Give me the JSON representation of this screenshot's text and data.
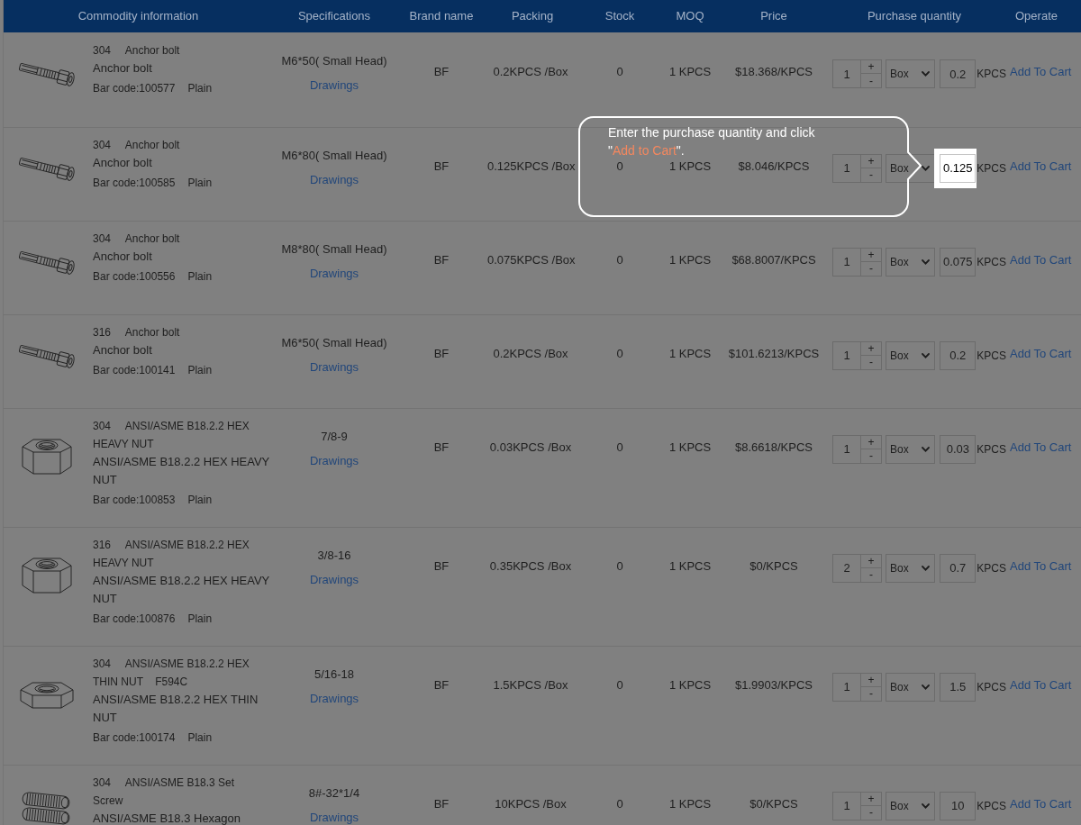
{
  "columns": [
    "Commodity information",
    "Specifications",
    "Brand name",
    "Packing",
    "Stock",
    "MOQ",
    "Price",
    "Purchase quantity",
    "Operate"
  ],
  "rows": [
    {
      "kind": "bolt",
      "grade": "304",
      "title": "Anchor bolt",
      "name": "Anchor bolt",
      "barcode": "Bar code:100577",
      "finish": "Plain",
      "spec": "M6*50( Small Head)",
      "drawings": "Drawings",
      "brand": "BF",
      "packing": "0.2KPCS /Box",
      "stock": "0",
      "moq": "1 KPCS",
      "price": "$18.368/KPCS",
      "quantity": "1",
      "step_up": "+",
      "step_down": "-",
      "unit": "Box",
      "amount": "0.2",
      "amount_unit": "KPCS",
      "highlighted": false,
      "action": "Add To Cart"
    },
    {
      "kind": "bolt",
      "grade": "304",
      "title": "Anchor bolt",
      "name": "Anchor bolt",
      "barcode": "Bar code:100585",
      "finish": "Plain",
      "spec": "M6*80( Small Head)",
      "drawings": "Drawings",
      "brand": "BF",
      "packing": "0.125KPCS /Box",
      "stock": "0",
      "moq": "1 KPCS",
      "price": "$8.046/KPCS",
      "quantity": "1",
      "step_up": "+",
      "step_down": "-",
      "unit": "Box",
      "amount": "0.125",
      "amount_unit": "KPCS",
      "highlighted": true,
      "action": "Add To Cart"
    },
    {
      "kind": "bolt",
      "grade": "304",
      "title": "Anchor bolt",
      "name": "Anchor bolt",
      "barcode": "Bar code:100556",
      "finish": "Plain",
      "spec": "M8*80( Small Head)",
      "drawings": "Drawings",
      "brand": "BF",
      "packing": "0.075KPCS /Box",
      "stock": "0",
      "moq": "1 KPCS",
      "price": "$68.8007/KPCS",
      "quantity": "1",
      "step_up": "+",
      "step_down": "-",
      "unit": "Box",
      "amount": "0.075",
      "amount_unit": "KPCS",
      "highlighted": false,
      "action": "Add To Cart"
    },
    {
      "kind": "bolt",
      "grade": "316",
      "title": "Anchor bolt",
      "name": "Anchor bolt",
      "barcode": "Bar code:100141",
      "finish": "Plain",
      "spec": "M6*50( Small Head)",
      "drawings": "Drawings",
      "brand": "BF",
      "packing": "0.2KPCS /Box",
      "stock": "0",
      "moq": "1 KPCS",
      "price": "$101.6213/KPCS",
      "quantity": "1",
      "step_up": "+",
      "step_down": "-",
      "unit": "Box",
      "amount": "0.2",
      "amount_unit": "KPCS",
      "highlighted": false,
      "action": "Add To Cart"
    },
    {
      "kind": "hex_nut",
      "grade": "304",
      "title": "ANSI/ASME B18.2.2 HEX HEAVY NUT",
      "name": "ANSI/ASME B18.2.2 HEX HEAVY NUT",
      "barcode": "Bar code:100853",
      "finish": "Plain",
      "spec": "7/8-9",
      "drawings": "Drawings",
      "brand": "BF",
      "packing": "0.03KPCS /Box",
      "stock": "0",
      "moq": "1 KPCS",
      "price": "$8.6618/KPCS",
      "quantity": "1",
      "step_up": "+",
      "step_down": "-",
      "unit": "Box",
      "amount": "0.03",
      "amount_unit": "KPCS",
      "highlighted": false,
      "action": "Add To Cart"
    },
    {
      "kind": "hex_nut",
      "grade": "316",
      "title": "ANSI/ASME B18.2.2 HEX HEAVY NUT",
      "name": "ANSI/ASME B18.2.2 HEX HEAVY NUT",
      "barcode": "Bar code:100876",
      "finish": "Plain",
      "spec": "3/8-16",
      "drawings": "Drawings",
      "brand": "BF",
      "packing": "0.35KPCS /Box",
      "stock": "0",
      "moq": "1 KPCS",
      "price": "$0/KPCS",
      "quantity": "2",
      "step_up": "+",
      "step_down": "-",
      "unit": "Box",
      "amount": "0.7",
      "amount_unit": "KPCS",
      "highlighted": false,
      "action": "Add To Cart"
    },
    {
      "kind": "thin_nut",
      "grade": "304",
      "title": "ANSI/ASME B18.2.2 HEX THIN NUT",
      "code": "F594C",
      "name": "ANSI/ASME B18.2.2 HEX THIN NUT",
      "barcode": "Bar code:100174",
      "finish": "Plain",
      "spec": "5/16-18",
      "drawings": "Drawings",
      "brand": "BF",
      "packing": "1.5KPCS /Box",
      "stock": "0",
      "moq": "1 KPCS",
      "price": "$1.9903/KPCS",
      "quantity": "1",
      "step_up": "+",
      "step_down": "-",
      "unit": "Box",
      "amount": "1.5",
      "amount_unit": "KPCS",
      "highlighted": false,
      "action": "Add To Cart"
    },
    {
      "kind": "set_screw",
      "grade": "304",
      "title": "ANSI/ASME B18.3 Set Screw",
      "name": "ANSI/ASME B18.3 Hexagon",
      "spec": "8#-32*1/4",
      "drawings": "Drawings",
      "brand": "BF",
      "packing": "10KPCS /Box",
      "stock": "0",
      "moq": "1 KPCS",
      "price": "$0/KPCS",
      "quantity": "1",
      "step_up": "+",
      "step_down": "-",
      "unit": "Box",
      "amount": "10",
      "amount_unit": "KPCS",
      "highlighted": false,
      "action": "Add To Cart"
    }
  ],
  "tooltip": {
    "text_before": "Enter the purchase quantity and click \"",
    "highlight": "Add to Cart",
    "text_after": "\"."
  }
}
